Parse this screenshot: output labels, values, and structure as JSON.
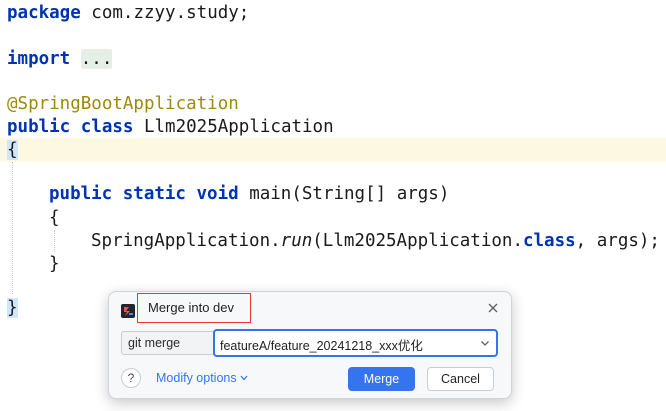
{
  "editor": {
    "package_kw": "package",
    "package_name": " com.zzyy.study;",
    "import_kw": "import",
    "import_folded": "...",
    "annotation": "@SpringBootApplication",
    "class_kw": "public class",
    "class_name": " Llm2025Application",
    "open_brace": "{",
    "method_kw": "public static void",
    "method_sig": " main(String[] args)",
    "method_open": "{",
    "call_prefix": "SpringApplication.",
    "call_method": "run",
    "call_args_1": "(Llm2025Application.",
    "call_class_kw": "class",
    "call_args_2": ", args);",
    "method_close": "}",
    "close_brace": "}",
    "colors": {
      "keyword": "#0033b3",
      "annotation": "#9e880d",
      "current_line": "#fdf8e1",
      "brace_highlight": "#cfe6fb"
    }
  },
  "merge_dialog": {
    "title": "Merge into dev",
    "command_label": "git merge",
    "branch_value": "featureA/feature_20241218_xxx优化",
    "help_label": "?",
    "modify_options_label": "Modify options",
    "merge_button": "Merge",
    "cancel_button": "Cancel",
    "icons": [
      "app-icon",
      "close-icon",
      "chevron-down-icon",
      "help-icon"
    ],
    "colors": {
      "accent": "#3574f0",
      "title_outline": "#e8373a"
    }
  }
}
